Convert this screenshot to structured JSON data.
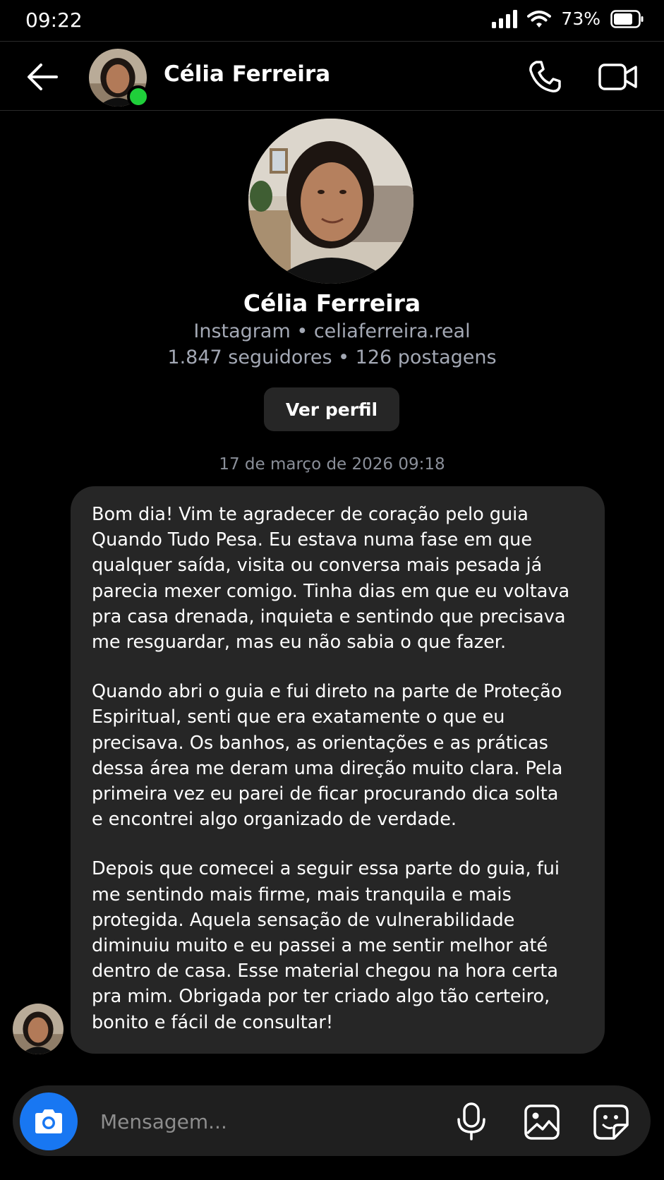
{
  "status_bar": {
    "time": "09:22",
    "battery_percent": "73%",
    "icons": [
      "signal-icon",
      "wifi-icon",
      "battery-icon"
    ]
  },
  "header": {
    "name": "Célia Ferreira",
    "online": true,
    "icons": [
      "back-arrow-icon",
      "phone-icon",
      "video-camera-icon"
    ]
  },
  "profile": {
    "name": "Célia Ferreira",
    "source_line": "Instagram • celiaferreira.real",
    "stats_line": "1.847 seguidores • 126 postagens",
    "view_profile_label": "Ver perfil"
  },
  "conversation": {
    "timestamp": "17 de março de 2026 09:18",
    "messages": [
      {
        "paragraphs": [
          "Bom dia! Vim te agradecer de coração pelo guia\nQuando Tudo Pesa. Eu estava numa fase em que\nqualquer saída, visita ou conversa mais pesada já\nparecia mexer comigo. Tinha dias em que eu voltava\npra casa drenada, inquieta e sentindo que precisava\nme resguardar, mas eu não sabia o que fazer.",
          "Quando abri o guia e fui direto na parte de Proteção\nEspiritual, senti que era exatamente o que eu\nprecisava. Os banhos, as orientações e as práticas\ndessa área me deram uma direção muito clara. Pela\nprimeira vez eu parei de ficar procurando dica solta\ne encontrei algo organizado de verdade.",
          "Depois que comecei a seguir essa parte do guia, fui\nme sentindo mais firme, mais tranquila e mais\nprotegida. Aquela sensação de vulnerabilidade\ndiminuiu muito e eu passei a me sentir melhor até\ndentro de casa. Esse material chegou na hora certa\npra mim. Obrigada por ter criado algo tão certeiro,\nbonito e fácil de consultar!"
        ]
      }
    ]
  },
  "composer": {
    "placeholder": "Mensagem...",
    "icons": [
      "camera-icon",
      "microphone-icon",
      "gallery-icon",
      "sticker-icon"
    ]
  },
  "colors": {
    "background": "#000000",
    "bubble": "#262626",
    "secondary_text": "#a3a8b4",
    "online_dot": "#1fcf3a",
    "camera_button": "#1877f2"
  }
}
